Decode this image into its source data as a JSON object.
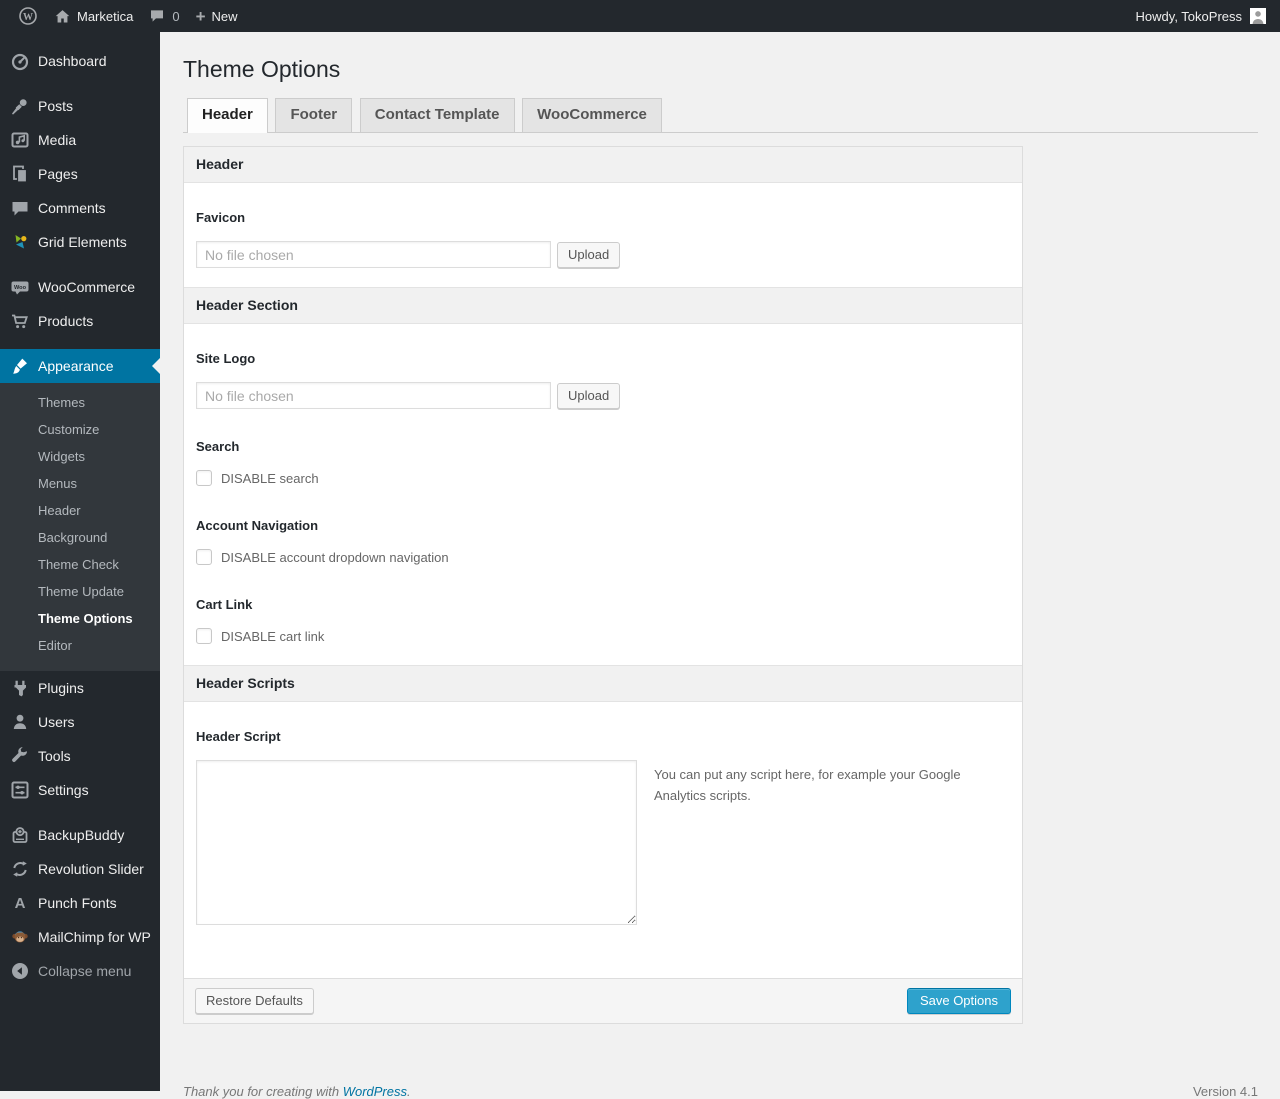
{
  "admin_bar": {
    "site_name": "Marketica",
    "comment_count": "0",
    "new_label": "New",
    "howdy": "Howdy, TokoPress"
  },
  "sidebar": {
    "items": [
      {
        "label": "Dashboard",
        "icon": "dashboard-icon"
      },
      {
        "label": "Posts",
        "icon": "pushpin-icon"
      },
      {
        "label": "Media",
        "icon": "media-icon"
      },
      {
        "label": "Pages",
        "icon": "pages-icon"
      },
      {
        "label": "Comments",
        "icon": "comment-icon"
      },
      {
        "label": "Grid Elements",
        "icon": "grid-elements-icon"
      },
      {
        "label": "WooCommerce",
        "icon": "woocommerce-icon"
      },
      {
        "label": "Products",
        "icon": "cart-icon"
      },
      {
        "label": "Appearance",
        "icon": "brush-icon",
        "active": true
      },
      {
        "label": "Plugins",
        "icon": "plug-icon"
      },
      {
        "label": "Users",
        "icon": "user-icon"
      },
      {
        "label": "Tools",
        "icon": "wrench-icon"
      },
      {
        "label": "Settings",
        "icon": "sliders-icon"
      },
      {
        "label": "BackupBuddy",
        "icon": "backup-icon"
      },
      {
        "label": "Revolution Slider",
        "icon": "cycle-arrows-icon"
      },
      {
        "label": "Punch Fonts",
        "icon": "letter-a-icon"
      },
      {
        "label": "MailChimp for WP",
        "icon": "monkey-icon"
      },
      {
        "label": "Collapse menu",
        "icon": "collapse-arrow-icon"
      }
    ],
    "appearance_submenu": {
      "items": [
        {
          "label": "Themes"
        },
        {
          "label": "Customize"
        },
        {
          "label": "Widgets"
        },
        {
          "label": "Menus"
        },
        {
          "label": "Header"
        },
        {
          "label": "Background"
        },
        {
          "label": "Theme Check"
        },
        {
          "label": "Theme Update"
        },
        {
          "label": "Theme Options",
          "current": true
        },
        {
          "label": "Editor"
        }
      ]
    }
  },
  "main": {
    "title": "Theme Options",
    "tabs": [
      {
        "label": "Header",
        "active": true
      },
      {
        "label": "Footer",
        "active": false
      },
      {
        "label": "Contact Template",
        "active": false
      },
      {
        "label": "WooCommerce",
        "active": false
      }
    ]
  },
  "panel": {
    "section_header": {
      "heading": "Header"
    },
    "favicon": {
      "label": "Favicon",
      "placeholder": "No file chosen",
      "button": "Upload"
    },
    "section_header_section": {
      "heading": "Header Section"
    },
    "site_logo": {
      "label": "Site Logo",
      "placeholder": "No file chosen",
      "button": "Upload"
    },
    "search": {
      "label": "Search",
      "checkbox_label": "DISABLE search",
      "checked": false
    },
    "account_navigation": {
      "label": "Account Navigation",
      "checkbox_label": "DISABLE account dropdown navigation",
      "checked": false
    },
    "cart_link": {
      "label": "Cart Link",
      "checkbox_label": "DISABLE cart link",
      "checked": false
    },
    "section_header_scripts": {
      "heading": "Header Scripts"
    },
    "header_script": {
      "label": "Header Script",
      "value": "",
      "help": "You can put any script here, for example your Google Analytics scripts."
    },
    "footer": {
      "restore_label": "Restore Defaults",
      "save_label": "Save Options"
    }
  },
  "page_footer": {
    "thanks_text": "Thank you for creating with",
    "wordpress_link": "WordPress",
    "suffix": ".",
    "version": "Version 4.1"
  },
  "colors": {
    "admin_bar_bg": "#23282d",
    "submenu_bg": "#32373c",
    "active_menu": "#0074a2",
    "primary_button": "#2ea2cc",
    "content_bg": "#f1f1f1"
  }
}
